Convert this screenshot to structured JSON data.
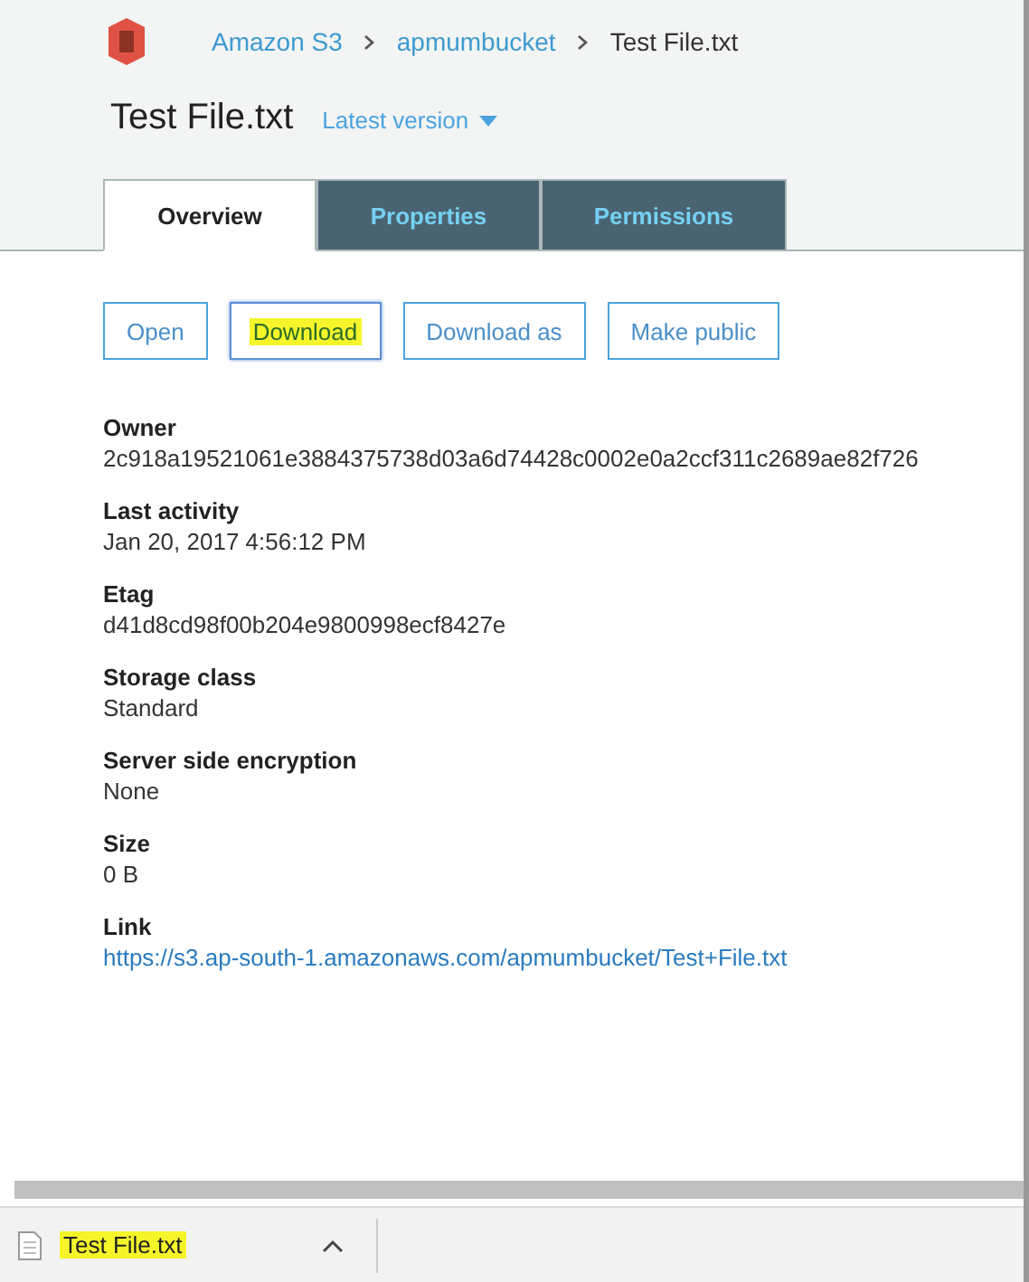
{
  "breadcrumb": [
    {
      "label": "Amazon S3",
      "link": true
    },
    {
      "label": "apmumbucket",
      "link": true
    },
    {
      "label": "Test File.txt",
      "link": false
    }
  ],
  "title": "Test File.txt",
  "version": {
    "label": "Latest version"
  },
  "tabs": [
    {
      "label": "Overview",
      "selected": true
    },
    {
      "label": "Properties",
      "selected": false
    },
    {
      "label": "Permissions",
      "selected": false
    }
  ],
  "buttons": [
    {
      "label": "Open",
      "highlighted": false
    },
    {
      "label": "Download",
      "highlighted": true
    },
    {
      "label": "Download as",
      "highlighted": false
    },
    {
      "label": "Make public",
      "highlighted": false
    }
  ],
  "fields": [
    {
      "label": "Owner",
      "value": "2c918a19521061e3884375738d03a6d74428c0002e0a2ccf311c2689ae82f726",
      "link": false
    },
    {
      "label": "Last activity",
      "value": "Jan 20, 2017 4:56:12 PM",
      "link": false
    },
    {
      "label": "Etag",
      "value": "d41d8cd98f00b204e9800998ecf8427e",
      "link": false
    },
    {
      "label": "Storage class",
      "value": "Standard",
      "link": false
    },
    {
      "label": "Server side encryption",
      "value": "None",
      "link": false
    },
    {
      "label": "Size",
      "value": "0 B",
      "link": false
    },
    {
      "label": "Link",
      "value": "https://s3.ap-south-1.amazonaws.com/apmumbucket/Test+File.txt",
      "link": true
    }
  ],
  "download_bar": {
    "file": "Test File.txt",
    "highlighted": true
  }
}
